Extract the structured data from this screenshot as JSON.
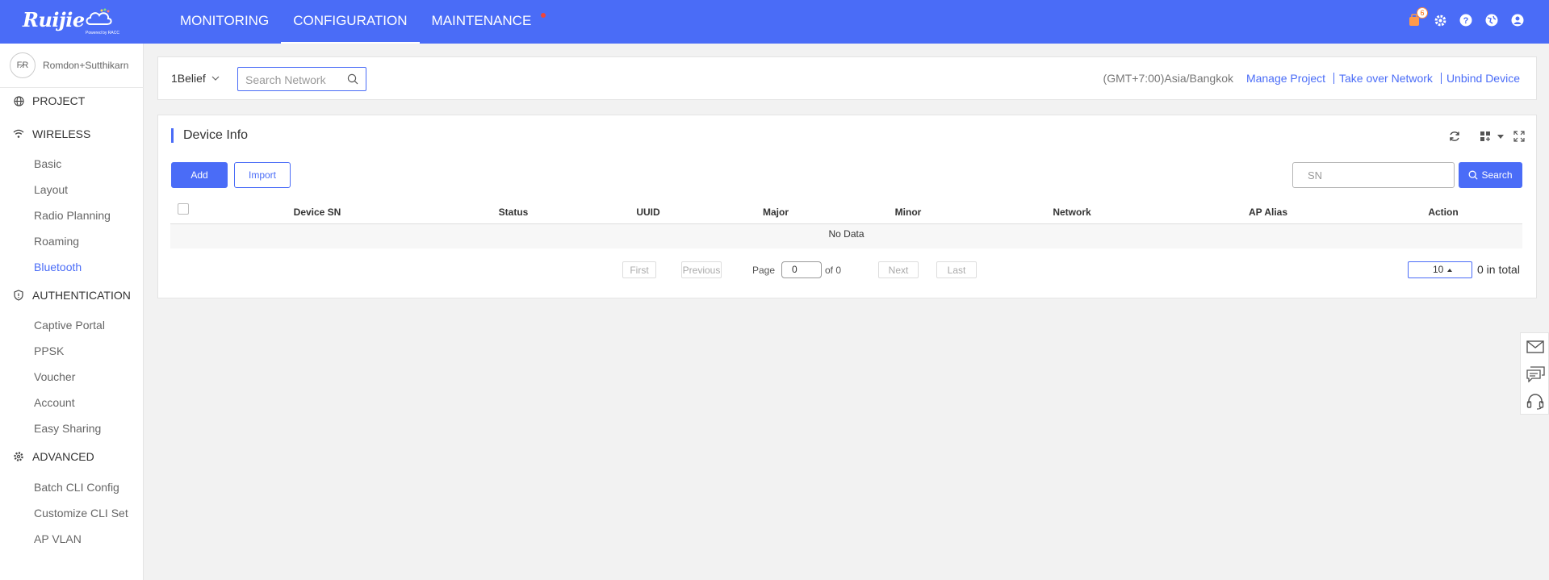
{
  "brand": {
    "name": "Ruijie",
    "powered": "Powered by RACC"
  },
  "topnav": [
    {
      "label": "MONITORING",
      "active": false
    },
    {
      "label": "CONFIGURATION",
      "active": true
    },
    {
      "label": "MAINTENANCE",
      "active": false,
      "dot": true
    }
  ],
  "topicons": {
    "notification_count": "6",
    "icons": [
      "bell-icon",
      "gear-icon",
      "help-icon",
      "globe-icon",
      "user-icon"
    ]
  },
  "sidebar": {
    "user": {
      "initials": "F̷R",
      "name": "Romdon+Sutthikarn"
    },
    "sections": [
      {
        "label": "PROJECT",
        "icon": "globe-icon"
      },
      {
        "label": "WIRELESS",
        "icon": "wifi-icon",
        "items": [
          "Basic",
          "Layout",
          "Radio Planning",
          "Roaming",
          "Bluetooth"
        ],
        "active_item": "Bluetooth"
      },
      {
        "label": "AUTHENTICATION",
        "icon": "shield-icon",
        "items": [
          "Captive Portal",
          "PPSK",
          "Voucher",
          "Account",
          "Easy Sharing"
        ]
      },
      {
        "label": "ADVANCED",
        "icon": "gear-icon",
        "items": [
          "Batch CLI Config",
          "Customize CLI Set",
          "AP VLAN"
        ]
      }
    ]
  },
  "filterbar": {
    "project": "1Belief",
    "search_placeholder": "Search Network",
    "timezone": "(GMT+7:00)Asia/Bangkok",
    "links": [
      "Manage Project",
      "Take over Network",
      "Unbind Device"
    ]
  },
  "panel": {
    "title": "Device Info",
    "add_label": "Add",
    "import_label": "Import",
    "sn_placeholder": "SN",
    "search_label": "Search",
    "columns": [
      "Device SN",
      "Status",
      "UUID",
      "Major",
      "Minor",
      "Network",
      "AP Alias",
      "Action"
    ],
    "empty_text": "No Data",
    "pagination": {
      "first": "First",
      "previous": "Previous",
      "page_label": "Page",
      "page_value": "0",
      "of_label": "of 0",
      "next": "Next",
      "last": "Last",
      "page_size": "10",
      "total": "0 in total"
    }
  },
  "floatbar": [
    "mail-icon",
    "chat-icon",
    "headset-icon"
  ],
  "colors": {
    "primary": "#4a6cf7",
    "badge": "#ff6a00",
    "dot": "#f0453a"
  }
}
